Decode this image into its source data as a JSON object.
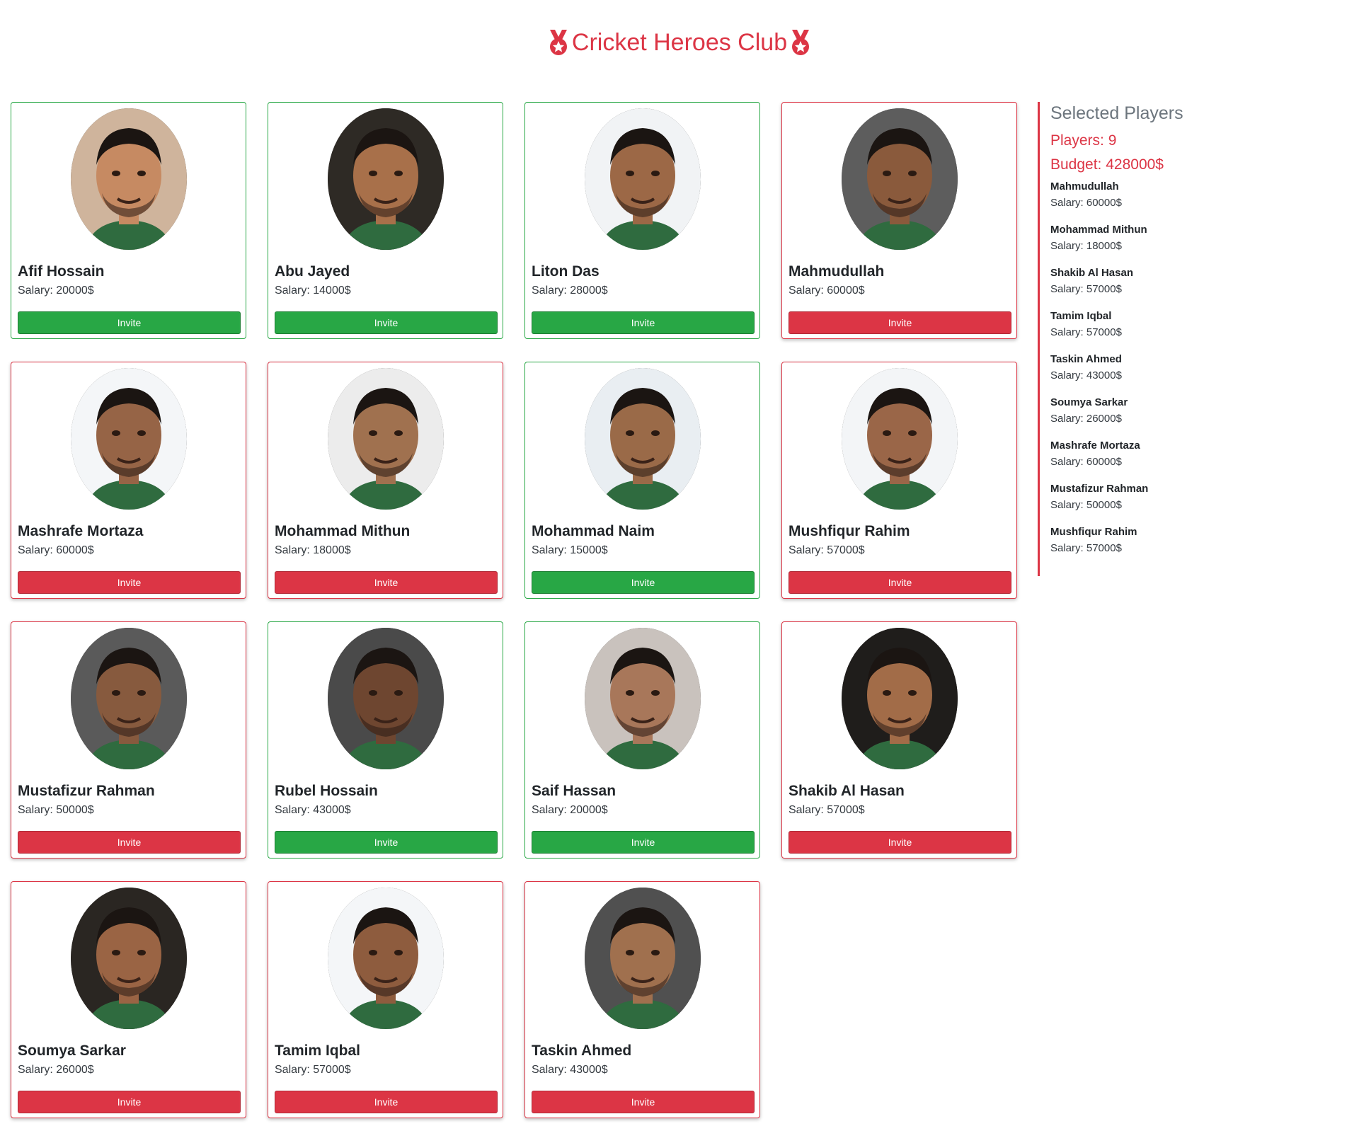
{
  "header": {
    "title": "Cricket Heroes Club",
    "icon": "medal-icon"
  },
  "colors": {
    "accent": "#dc3545",
    "invite": "#28a745",
    "selected": "#dc3545"
  },
  "players": [
    {
      "name": "Afif Hossain",
      "salary": "Salary: 20000$",
      "button": "Invite",
      "selected": false,
      "skin": "#c68a62",
      "bg": "#cfb49c"
    },
    {
      "name": "Abu Jayed",
      "salary": "Salary: 14000$",
      "button": "Invite",
      "selected": false,
      "skin": "#a8704a",
      "bg": "#2e2a25"
    },
    {
      "name": "Liton Das",
      "salary": "Salary: 28000$",
      "button": "Invite",
      "selected": false,
      "skin": "#9c6846",
      "bg": "#f1f3f5"
    },
    {
      "name": "Mahmudullah",
      "salary": "Salary: 60000$",
      "button": "Invite",
      "selected": true,
      "skin": "#8a5a3c",
      "bg": "#5d5d5d"
    },
    {
      "name": "Mashrafe Mortaza",
      "salary": "Salary: 60000$",
      "button": "Invite",
      "selected": true,
      "skin": "#966446",
      "bg": "#f4f6f8"
    },
    {
      "name": "Mohammad Mithun",
      "salary": "Salary: 18000$",
      "button": "Invite",
      "selected": true,
      "skin": "#a0714f",
      "bg": "#ececec"
    },
    {
      "name": "Mohammad Naim",
      "salary": "Salary: 15000$",
      "button": "Invite",
      "selected": false,
      "skin": "#9a6a48",
      "bg": "#e9eef2"
    },
    {
      "name": "Mushfiqur Rahim",
      "salary": "Salary: 57000$",
      "button": "Invite",
      "selected": true,
      "skin": "#9a6648",
      "bg": "#f3f5f7"
    },
    {
      "name": "Mustafizur Rahman",
      "salary": "Salary: 50000$",
      "button": "Invite",
      "selected": true,
      "skin": "#875a3e",
      "bg": "#5a5a5a"
    },
    {
      "name": "Rubel Hossain",
      "salary": "Salary: 43000$",
      "button": "Invite",
      "selected": false,
      "skin": "#6e4630",
      "bg": "#4a4a4a"
    },
    {
      "name": "Saif Hassan",
      "salary": "Salary: 20000$",
      "button": "Invite",
      "selected": false,
      "skin": "#a8775a",
      "bg": "#c9c2bd"
    },
    {
      "name": "Shakib Al Hasan",
      "salary": "Salary: 57000$",
      "button": "Invite",
      "selected": true,
      "skin": "#a26c48",
      "bg": "#1f1d1b"
    },
    {
      "name": "Soumya Sarkar",
      "salary": "Salary: 26000$",
      "button": "Invite",
      "selected": true,
      "skin": "#9a6444",
      "bg": "#2a2622"
    },
    {
      "name": "Tamim Iqbal",
      "salary": "Salary: 57000$",
      "button": "Invite",
      "selected": true,
      "skin": "#8e5c3e",
      "bg": "#f4f6f8"
    },
    {
      "name": "Taskin Ahmed",
      "salary": "Salary: 43000$",
      "button": "Invite",
      "selected": true,
      "skin": "#a0704e",
      "bg": "#505050"
    }
  ],
  "sidebar": {
    "title": "Selected Players",
    "count_label": "Players: 9",
    "budget_label": "Budget: 428000$",
    "selected": [
      {
        "name": "Mahmudullah",
        "salary": "Salary: 60000$"
      },
      {
        "name": "Mohammad Mithun",
        "salary": "Salary: 18000$"
      },
      {
        "name": "Shakib Al Hasan",
        "salary": "Salary: 57000$"
      },
      {
        "name": "Tamim Iqbal",
        "salary": "Salary: 57000$"
      },
      {
        "name": "Taskin Ahmed",
        "salary": "Salary: 43000$"
      },
      {
        "name": "Soumya Sarkar",
        "salary": "Salary: 26000$"
      },
      {
        "name": "Mashrafe Mortaza",
        "salary": "Salary: 60000$"
      },
      {
        "name": "Mustafizur Rahman",
        "salary": "Salary: 50000$"
      },
      {
        "name": "Mushfiqur Rahim",
        "salary": "Salary: 57000$"
      }
    ]
  }
}
